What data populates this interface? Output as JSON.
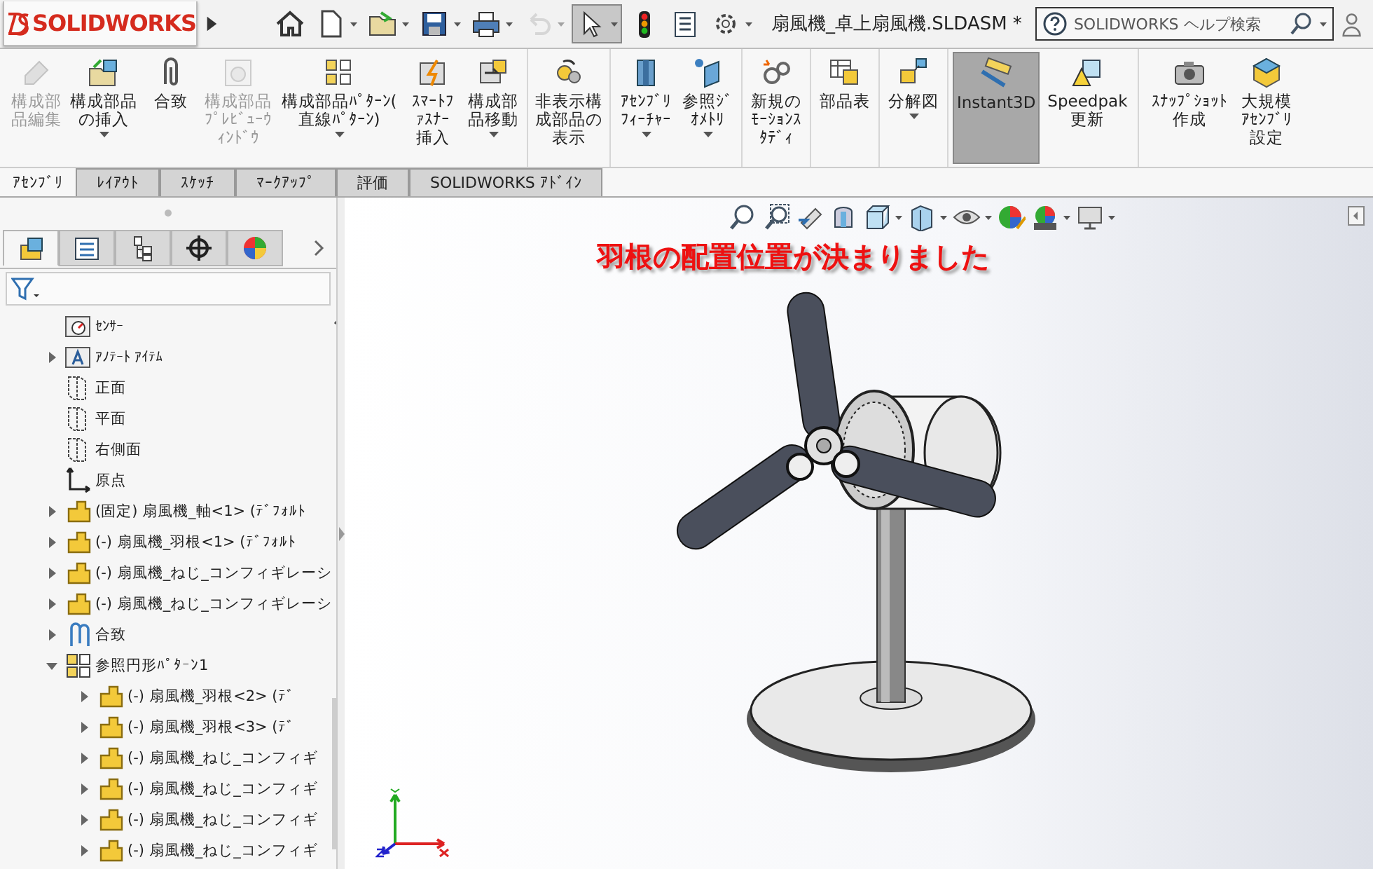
{
  "title_bar": {
    "logo": "SOLIDWORKS",
    "document_title": "扇風機_卓上扇風機.SLDASM *",
    "search": {
      "placeholder": "SOLIDWORKS ヘルプ検索"
    },
    "tools": [
      {
        "dropdown": false,
        "disabled": false,
        "selected": false
      },
      {
        "dropdown": true,
        "disabled": false,
        "selected": false
      },
      {
        "dropdown": true,
        "disabled": false,
        "selected": false
      },
      {
        "dropdown": true,
        "disabled": false,
        "selected": false
      },
      {
        "dropdown": true,
        "disabled": false,
        "selected": false
      },
      {
        "dropdown": true,
        "disabled": true,
        "selected": false
      },
      {
        "dropdown": true,
        "disabled": false,
        "selected": true
      },
      {
        "dropdown": false,
        "disabled": false,
        "selected": false
      },
      {
        "dropdown": false,
        "disabled": false,
        "selected": false
      },
      {
        "dropdown": true,
        "disabled": false,
        "selected": false
      }
    ]
  },
  "ribbon": {
    "groups": [
      {
        "buttons": [
          {
            "label": "構成部品編集",
            "disabled": true,
            "dropdown": false,
            "selected": false
          },
          {
            "label": "構成部品の挿入",
            "disabled": false,
            "dropdown": true,
            "selected": false
          },
          {
            "label": "合致",
            "disabled": false,
            "dropdown": false,
            "selected": false
          },
          {
            "label": "構成部品ﾌﾟﾚﾋﾞｭｰｳｨﾝﾄﾞｳ",
            "disabled": true,
            "dropdown": false,
            "selected": false
          },
          {
            "label": "構成部品ﾊﾟﾀｰﾝ(直線ﾊﾟﾀｰﾝ)",
            "disabled": false,
            "dropdown": true,
            "selected": false
          },
          {
            "label": "ｽﾏｰﾄﾌｧｽﾅｰ挿入",
            "disabled": false,
            "dropdown": false,
            "selected": false
          },
          {
            "label": "構成部品移動",
            "disabled": false,
            "dropdown": true,
            "selected": false
          }
        ]
      },
      {
        "buttons": [
          {
            "label": "非表示構成部品の表示",
            "disabled": false,
            "dropdown": false,
            "selected": false
          }
        ]
      },
      {
        "buttons": [
          {
            "label": "ｱｾﾝﾌﾞﾘﾌｨｰﾁｬｰ",
            "disabled": false,
            "dropdown": true,
            "selected": false
          },
          {
            "label": "参照ｼﾞｵﾒﾄﾘ",
            "disabled": false,
            "dropdown": true,
            "selected": false
          }
        ]
      },
      {
        "buttons": [
          {
            "label": "新規のﾓｰｼｮﾝｽﾀﾃﾞｨ",
            "disabled": false,
            "dropdown": false,
            "selected": false
          }
        ]
      },
      {
        "buttons": [
          {
            "label": "部品表",
            "disabled": false,
            "dropdown": false,
            "selected": false
          }
        ]
      },
      {
        "buttons": [
          {
            "label": "分解図",
            "disabled": false,
            "dropdown": true,
            "selected": false
          }
        ]
      },
      {
        "buttons": [
          {
            "label": "Instant3D",
            "disabled": false,
            "dropdown": false,
            "selected": true
          },
          {
            "label": "Speedpak更新",
            "disabled": false,
            "dropdown": false,
            "selected": false
          }
        ]
      },
      {
        "buttons": [
          {
            "label": "ｽﾅｯﾌﾟｼｮｯﾄ作成",
            "disabled": false,
            "dropdown": false,
            "selected": false
          },
          {
            "label": "大規模ｱｾﾝﾌﾞﾘ設定",
            "disabled": false,
            "dropdown": false,
            "selected": false
          }
        ]
      }
    ]
  },
  "command_tabs": [
    {
      "label": "ｱｾﾝﾌﾞﾘ",
      "selected": true
    },
    {
      "label": "ﾚｲｱｳﾄ",
      "selected": false
    },
    {
      "label": "ｽｹｯﾁ",
      "selected": false
    },
    {
      "label": "ﾏｰｸｱｯﾌﾟ",
      "selected": false
    },
    {
      "label": "評価",
      "selected": false
    },
    {
      "label": "SOLIDWORKS ｱﾄﾞｲﾝ",
      "selected": false
    }
  ],
  "tree_panel": {
    "tabs": [
      {
        "selected": true
      },
      {
        "selected": false
      },
      {
        "selected": false
      },
      {
        "selected": false
      },
      {
        "selected": false
      }
    ],
    "tree": [
      {
        "label": "ｾﾝｻｰ"
      },
      {
        "label": "ｱﾉﾃｰﾄ ｱｲﾃﾑ",
        "expanded": false
      },
      {
        "label": "正面"
      },
      {
        "label": "平面"
      },
      {
        "label": "右側面"
      },
      {
        "label": "原点"
      },
      {
        "label": "(固定) 扇風機_軸<1> (ﾃﾞﾌｫﾙﾄ",
        "expanded": false
      },
      {
        "label": "(-) 扇風機_羽根<1> (ﾃﾞﾌｫﾙﾄ",
        "expanded": false
      },
      {
        "label": "(-) 扇風機_ねじ_コンフィギレーシ",
        "expanded": false
      },
      {
        "label": "(-) 扇風機_ねじ_コンフィギレーシ",
        "expanded": false
      },
      {
        "label": "合致",
        "expanded": false
      },
      {
        "label": "参照円形ﾊﾟﾀｰﾝ1",
        "expanded": true,
        "children": [
          {
            "label": "(-) 扇風機_羽根<2> (ﾃﾞ",
            "expanded": false
          },
          {
            "label": "(-) 扇風機_羽根<3> (ﾃﾞ",
            "expanded": false
          },
          {
            "label": "(-) 扇風機_ねじ_コンフィギ",
            "expanded": false
          },
          {
            "label": "(-) 扇風機_ねじ_コンフィギ",
            "expanded": false
          },
          {
            "label": "(-) 扇風機_ねじ_コンフィギ",
            "expanded": false
          },
          {
            "label": "(-) 扇風機_ねじ_コンフィギ",
            "expanded": false
          }
        ]
      }
    ]
  },
  "view_toolbar": [
    {
      "dropdown": false
    },
    {
      "dropdown": false
    },
    {
      "dropdown": false
    },
    {
      "dropdown": false
    },
    {
      "dropdown": true
    },
    {
      "dropdown": true
    },
    {
      "dropdown": true
    },
    {
      "dropdown": false
    },
    {
      "dropdown": true
    },
    {
      "dropdown": true
    }
  ],
  "viewport": {
    "caption": "羽根の配置位置が決まりました"
  }
}
